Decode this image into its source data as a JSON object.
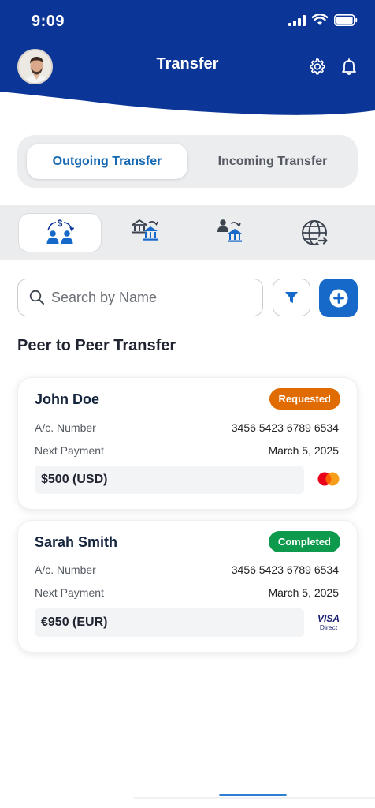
{
  "status_bar": {
    "time": "9:09"
  },
  "header": {
    "title": "Transfer"
  },
  "tabs": [
    {
      "label": "Outgoing Transfer",
      "active": true
    },
    {
      "label": "Incoming Transfer",
      "active": false
    }
  ],
  "categories": [
    {
      "icon": "peer-to-peer-transfer-icon",
      "active": true
    },
    {
      "icon": "bank-to-bank-transfer-icon",
      "active": false
    },
    {
      "icon": "person-to-bank-transfer-icon",
      "active": false
    },
    {
      "icon": "international-transfer-icon",
      "active": false
    }
  ],
  "search": {
    "placeholder": "Search by Name",
    "value": ""
  },
  "section_title": "Peer to Peer Transfer",
  "transfers": [
    {
      "name": "John Doe",
      "status": "Requested",
      "status_color": "#e06b00",
      "account_label": "A/c. Number",
      "account_number": "3456 5423 6789 6534",
      "next_payment_label": "Next Payment",
      "next_payment_date": "March 5, 2025",
      "amount": "$500 (USD)",
      "card_brand": "mastercard-logo"
    },
    {
      "name": "Sarah Smith",
      "status": "Completed",
      "status_color": "#0e9a4c",
      "account_label": "A/c. Number",
      "account_number": "3456 5423 6789 6534",
      "next_payment_label": "Next Payment",
      "next_payment_date": "March 5, 2025",
      "amount": "€950 (EUR)",
      "card_brand": "visa-direct-logo",
      "card_brand_text": [
        "VISA",
        "Direct"
      ]
    }
  ],
  "colors": {
    "header_blue": "#0b3596",
    "accent_blue": "#1769c9",
    "active_tab_text": "#1769b3"
  }
}
